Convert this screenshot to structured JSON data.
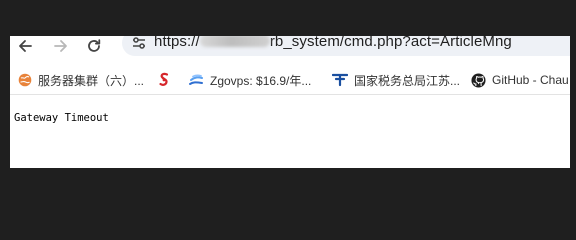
{
  "toolbar": {
    "back_icon": "arrow-left-icon",
    "forward_icon": "arrow-right-icon",
    "reload_icon": "reload-icon",
    "site_info_icon": "tune-icon",
    "url_prefix": "https://",
    "url_suffix": "rb_system/cmd.php?act=ArticleMng"
  },
  "bookmarks": [
    {
      "icon": "globe-icon",
      "label": "服务器集群（六）..."
    },
    {
      "icon": "red-s-logo-icon",
      "label": ""
    },
    {
      "icon": "zgovps-icon",
      "label": "Zgovps: $16.9/年..."
    },
    {
      "icon": "tax-logo-icon",
      "label": "国家税务总局江苏..."
    },
    {
      "icon": "github-icon",
      "label": "GitHub - Chau"
    }
  ],
  "page": {
    "message": "Gateway Timeout"
  },
  "colors": {
    "outer_background": "#1f1f1f",
    "omnibox_background": "#eef1f6",
    "link_blue": "#1a73e8"
  }
}
